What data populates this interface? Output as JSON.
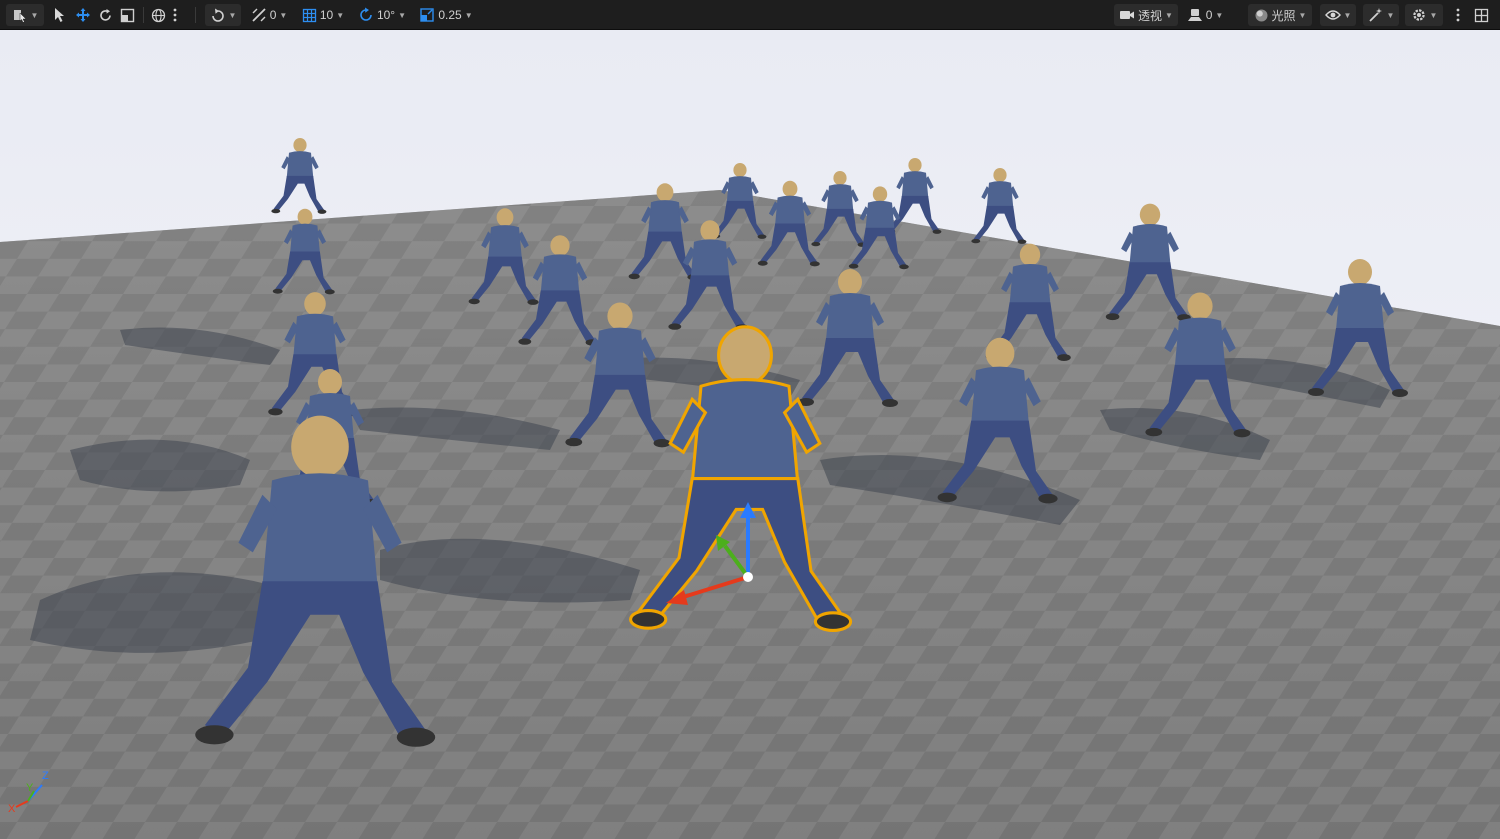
{
  "toolbar": {
    "snap_grid_value": "0",
    "grid_size": "10",
    "rotation_snap": "10°",
    "scale_snap": "0.25",
    "view_mode": "透视",
    "camera_speed": "0",
    "lighting_mode": "光照"
  },
  "viewport": {
    "axis_labels": {
      "x": "X",
      "y": "Y",
      "z": "Z"
    }
  },
  "colors": {
    "toolbar_bg": "#1e1e1e",
    "accent_blue": "#2d8ef0",
    "selection_outline": "#f0a500",
    "gizmo_x": "#e53a1c",
    "gizmo_y": "#4caf1c",
    "gizmo_z": "#2a7bff"
  }
}
